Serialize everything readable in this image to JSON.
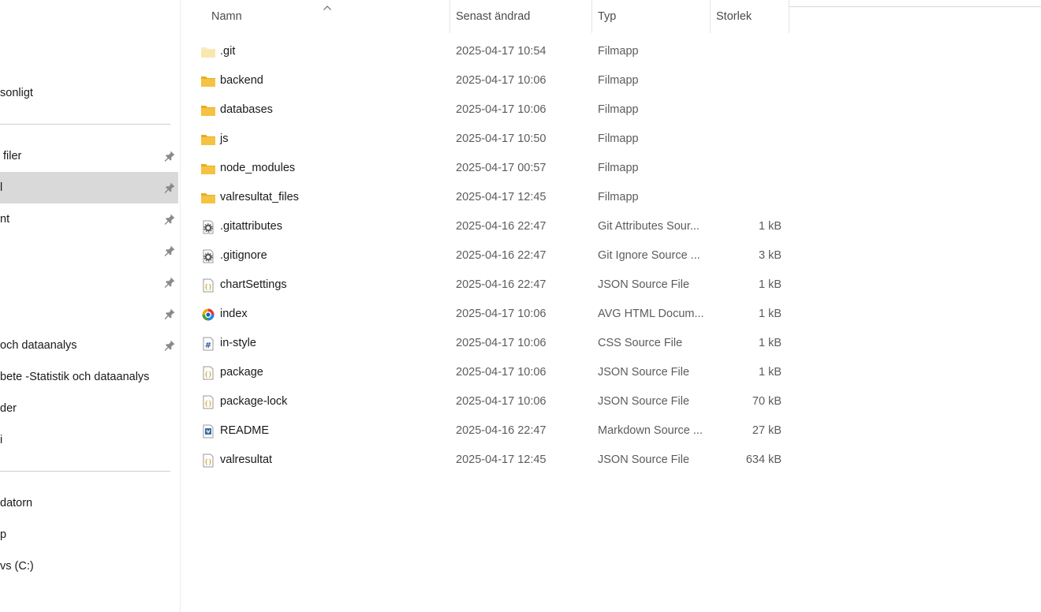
{
  "sidebar": {
    "items": [
      {
        "label": "sonligt",
        "pinned": false,
        "selected": false
      },
      {
        "label": "filer",
        "pinned": true,
        "selected": false
      },
      {
        "label": "l",
        "pinned": true,
        "selected": true
      },
      {
        "label": "nt",
        "pinned": true,
        "selected": false
      },
      {
        "label": "",
        "pinned": true,
        "selected": false
      },
      {
        "label": "",
        "pinned": true,
        "selected": false
      },
      {
        "label": "",
        "pinned": true,
        "selected": false
      },
      {
        "label": "och dataanalys",
        "pinned": true,
        "selected": false
      },
      {
        "label": "bete -Statistik och dataanalys",
        "pinned": false,
        "selected": false
      },
      {
        "label": "der",
        "pinned": false,
        "selected": false
      },
      {
        "label": "i",
        "pinned": false,
        "selected": false
      },
      {
        "label": "datorn",
        "pinned": false,
        "selected": false
      },
      {
        "label": "p",
        "pinned": false,
        "selected": false
      },
      {
        "label": "vs (C:)",
        "pinned": false,
        "selected": false
      }
    ]
  },
  "columns": {
    "name": "Namn",
    "modified": "Senast ändrad",
    "type": "Typ",
    "size": "Storlek"
  },
  "files": [
    {
      "name": ".git",
      "modified": "2025-04-17 10:54",
      "type": "Filmapp",
      "size": "",
      "icon": "folder-hidden-icon"
    },
    {
      "name": "backend",
      "modified": "2025-04-17 10:06",
      "type": "Filmapp",
      "size": "",
      "icon": "folder-icon"
    },
    {
      "name": "databases",
      "modified": "2025-04-17 10:06",
      "type": "Filmapp",
      "size": "",
      "icon": "folder-icon"
    },
    {
      "name": "js",
      "modified": "2025-04-17 10:50",
      "type": "Filmapp",
      "size": "",
      "icon": "folder-icon"
    },
    {
      "name": "node_modules",
      "modified": "2025-04-17 00:57",
      "type": "Filmapp",
      "size": "",
      "icon": "folder-icon"
    },
    {
      "name": "valresultat_files",
      "modified": "2025-04-17 12:45",
      "type": "Filmapp",
      "size": "",
      "icon": "folder-icon"
    },
    {
      "name": ".gitattributes",
      "modified": "2025-04-16 22:47",
      "type": "Git Attributes Sour...",
      "size": "1 kB",
      "icon": "config-file-icon"
    },
    {
      "name": ".gitignore",
      "modified": "2025-04-16 22:47",
      "type": "Git Ignore Source ...",
      "size": "3 kB",
      "icon": "config-file-icon"
    },
    {
      "name": "chartSettings",
      "modified": "2025-04-16 22:47",
      "type": "JSON Source File",
      "size": "1 kB",
      "icon": "json-file-icon"
    },
    {
      "name": "index",
      "modified": "2025-04-17 10:06",
      "type": "AVG HTML Docum...",
      "size": "1 kB",
      "icon": "avg-browser-icon"
    },
    {
      "name": "in-style",
      "modified": "2025-04-17 10:06",
      "type": "CSS Source File",
      "size": "1 kB",
      "icon": "css-file-icon"
    },
    {
      "name": "package",
      "modified": "2025-04-17 10:06",
      "type": "JSON Source File",
      "size": "1 kB",
      "icon": "json-file-icon"
    },
    {
      "name": "package-lock",
      "modified": "2025-04-17 10:06",
      "type": "JSON Source File",
      "size": "70 kB",
      "icon": "json-file-icon"
    },
    {
      "name": "README",
      "modified": "2025-04-16 22:47",
      "type": "Markdown Source ...",
      "size": "27 kB",
      "icon": "markdown-file-icon"
    },
    {
      "name": "valresultat",
      "modified": "2025-04-17 12:45",
      "type": "JSON Source File",
      "size": "634 kB",
      "icon": "json-file-icon"
    }
  ],
  "colors": {
    "folder": "#f5c342",
    "selection": "#d9d9d9",
    "secondary_text": "#5c5c5c",
    "header_text": "#4b4b4b"
  }
}
